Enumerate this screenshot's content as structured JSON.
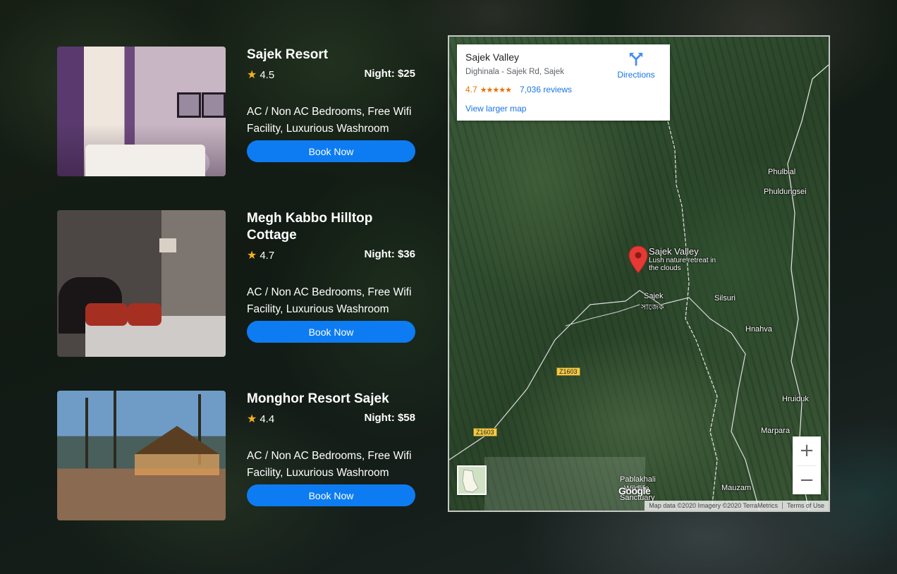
{
  "listings": [
    {
      "name": "Sajek Resort",
      "rating": "4.5",
      "price": "Night: $25",
      "description": "AC / Non AC Bedrooms, Free Wifi Facility, Luxurious Washroom",
      "button": "Book Now"
    },
    {
      "name": "Megh Kabbo Hilltop Cottage",
      "rating": "4.7",
      "price": "Night: $36",
      "description": "AC / Non AC Bedrooms, Free Wifi Facility, Luxurious Washroom",
      "button": "Book Now"
    },
    {
      "name": "Monghor Resort Sajek",
      "rating": "4.4",
      "price": "Night: $58",
      "description": "AC / Non AC Bedrooms, Free Wifi Facility, Luxurious Washroom",
      "button": "Book Now"
    }
  ],
  "map": {
    "place_name": "Sajek Valley",
    "address": "Dighinala - Sajek Rd, Sajek",
    "rating": "4.7",
    "stars": "★★★★★",
    "reviews": "7,036 reviews",
    "larger_map": "View larger map",
    "directions": "Directions",
    "pin_title": "Sajek Valley",
    "pin_subtitle": "Lush nature retreat in the clouds",
    "labels": {
      "phulbial": "Phulbial",
      "phuldungsei": "Phuldungsei",
      "sajek": "Sajek",
      "sajek_bn": "সাজেক",
      "silsuri": "Silsuri",
      "hnahva": "Hnahva",
      "hruiduk": "Hruiduk",
      "marpara": "Marpara",
      "mauzam": "Mauzam",
      "pablakhali": "Pablakhali",
      "wildlife": "Wildlife",
      "sanctuary": "Sanctuary",
      "road1": "Z1603",
      "road2": "Z1603"
    },
    "zoom_in": "+",
    "zoom_out": "−",
    "google": "Google",
    "attribution": "Map data ©2020 Imagery ©2020 TerraMetrics",
    "terms": "Terms of Use"
  },
  "colors": {
    "button": "#0d7cf2",
    "star": "#f6b21b",
    "link": "#1a73e8",
    "map_rating": "#e37400",
    "pin": "#e53935"
  }
}
